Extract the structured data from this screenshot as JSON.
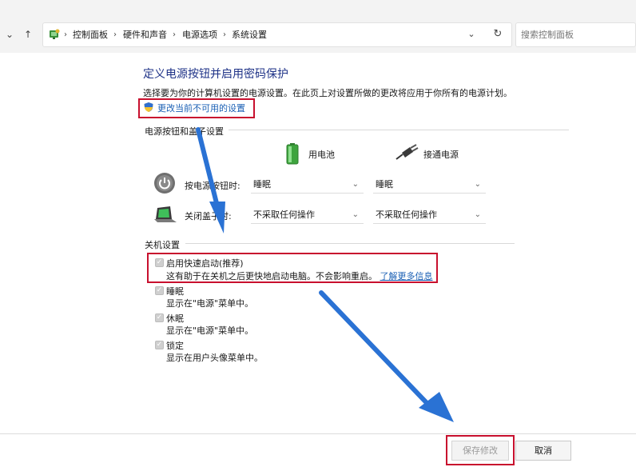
{
  "nav": {
    "back_icon": "chevron-down-icon",
    "up_icon": "up-arrow-icon",
    "refresh_icon": "refresh-icon",
    "breadcrumb": [
      "控制面板",
      "硬件和声音",
      "电源选项",
      "系统设置"
    ],
    "search_placeholder": "搜索控制面板"
  },
  "main": {
    "title": "定义电源按钮并启用密码保护",
    "description": "选择要为你的计算机设置的电源设置。在此页上对设置所做的更改将应用于你所有的电源计划。",
    "change_settings_link": "更改当前不可用的设置",
    "power_section": {
      "title": "电源按钮和盖子设置",
      "col_battery": "用电池",
      "col_plugged": "接通电源",
      "rows": [
        {
          "label": "按电源按钮时:",
          "battery": "睡眠",
          "plugged": "睡眠"
        },
        {
          "label": "关闭盖子时:",
          "battery": "不采取任何操作",
          "plugged": "不采取任何操作"
        }
      ]
    },
    "shutdown_section": {
      "title": "关机设置",
      "items": [
        {
          "label": "启用快速启动(推荐)",
          "desc": "这有助于在关机之后更快地启动电脑。不会影响重启。",
          "link": "了解更多信息",
          "checked": true
        },
        {
          "label": "睡眠",
          "desc": "显示在\"电源\"菜单中。",
          "checked": true
        },
        {
          "label": "休眠",
          "desc": "显示在\"电源\"菜单中。",
          "checked": true
        },
        {
          "label": "锁定",
          "desc": "显示在用户头像菜单中。",
          "checked": true
        }
      ]
    }
  },
  "footer": {
    "save_label": "保存修改",
    "cancel_label": "取消"
  },
  "colors": {
    "title": "#1e3287",
    "link": "#1a5fb4",
    "highlight_box": "#c8102e",
    "annotation_arrow": "#2a72d4"
  }
}
